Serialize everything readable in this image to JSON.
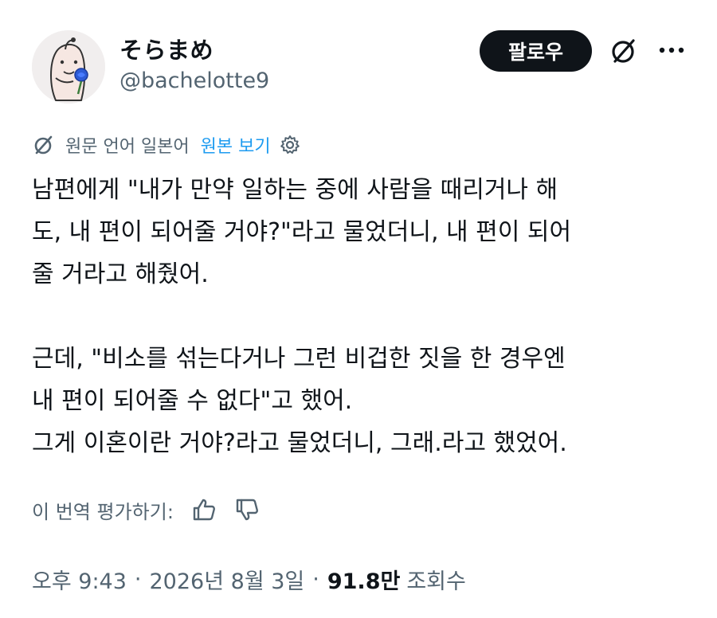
{
  "author": {
    "display_name": "そらまめ",
    "handle": "@bachelotte9"
  },
  "header": {
    "follow_label": "팔로우",
    "icons": [
      "translate-icon",
      "more-icon"
    ]
  },
  "translation": {
    "source_text": "원문 언어 일본어",
    "view_original_label": "원본 보기",
    "icons": [
      "translate-icon",
      "gear-icon"
    ]
  },
  "tweet": {
    "paragraph_1": "남편에게 \"내가 만약 일하는 중에 사람을 때리거나 해\n도, 내 편이 되어줄 거야?\"라고 물었더니, 내 편이 되어\n줄 거라고 해줬어.",
    "paragraph_2": "근데, \"비소를 섞는다거나 그런 비겁한 짓을 한 경우엔\n내 편이 되어줄 수 없다\"고 했어.",
    "paragraph_3": "그게 이혼이란 거야?라고 물었더니, 그래.라고 했었어."
  },
  "rating": {
    "label": "이 번역 평가하기:",
    "icons": [
      "thumbs-up-icon",
      "thumbs-down-icon"
    ]
  },
  "meta": {
    "time": "오후 9:43",
    "date": "2026년 8월 3일",
    "separator": "·",
    "views_count": "91.8만",
    "views_label": "조회수"
  },
  "colors": {
    "text": "#0f1419",
    "secondary": "#536471",
    "link": "#1d9bf0",
    "follow_bg": "#0f1419"
  }
}
